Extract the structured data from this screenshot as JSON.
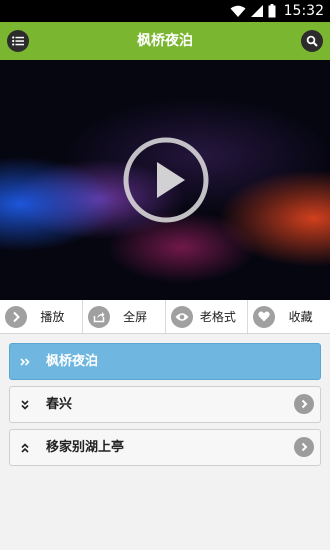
{
  "status": {
    "time": "15:32"
  },
  "appbar": {
    "title": "枫桥夜泊",
    "menu_icon": "list-menu-icon",
    "search_icon": "search-icon"
  },
  "player": {
    "play_icon": "play-icon"
  },
  "actions": [
    {
      "label": "播放",
      "icon": "play-icon"
    },
    {
      "label": "全屏",
      "icon": "share-icon"
    },
    {
      "label": "老格式",
      "icon": "eye-icon"
    },
    {
      "label": "收藏",
      "icon": "heart-icon"
    }
  ],
  "list": [
    {
      "label": "枫桥夜泊",
      "active": true
    },
    {
      "label": "春兴",
      "active": false
    },
    {
      "label": "移家别湖上亭",
      "active": false
    }
  ],
  "colors": {
    "appbar": "#7ab62f",
    "active_item": "#6fb7e0",
    "statusbar": "#000000"
  }
}
